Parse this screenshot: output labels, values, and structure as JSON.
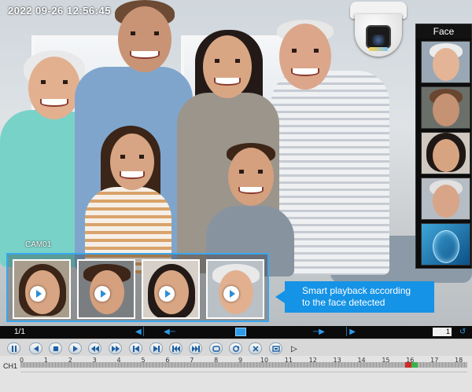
{
  "osd": {
    "timestamp": "2022  09-26  12:56:45",
    "channel": "CAM01"
  },
  "face_panel": {
    "title": "Face",
    "items": [
      "face-grandma",
      "face-dad",
      "face-mom",
      "face-grandpa",
      "face-scan"
    ]
  },
  "thumbnails": [
    {
      "subject": "girl",
      "action": "play-icon"
    },
    {
      "subject": "boy",
      "action": "play-icon"
    },
    {
      "subject": "mother",
      "action": "play-icon"
    },
    {
      "subject": "grandmother",
      "action": "play-icon"
    }
  ],
  "callout": {
    "line1": "Smart playback according",
    "line2": "to the face detected"
  },
  "nav": {
    "page_indicator": "1/1",
    "page_value": "1"
  },
  "controls": [
    "pause",
    "rewind",
    "stop",
    "play",
    "fast-reverse",
    "fast-forward",
    "frame-back",
    "frame-forward",
    "skip-back",
    "skip-forward",
    "loop",
    "sync",
    "close",
    "snapshot"
  ],
  "timeline": {
    "channel": "CH1",
    "hours": [
      "0",
      "1",
      "2",
      "3",
      "4",
      "5",
      "6",
      "7",
      "8",
      "9",
      "10",
      "11",
      "12",
      "13",
      "14",
      "15",
      "16",
      "17",
      "18"
    ],
    "segments_colors": [
      "#d12a2a",
      "#3bb34a"
    ]
  },
  "colors": {
    "accent_blue": "#1593e6",
    "event_red": "#d12a2a",
    "event_green": "#3bb34a"
  }
}
